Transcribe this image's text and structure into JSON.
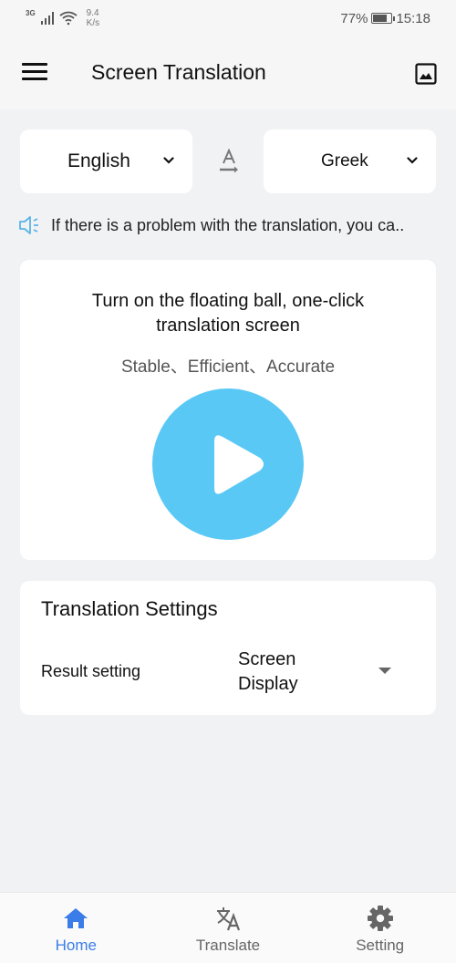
{
  "status_bar": {
    "network_type": "3G",
    "speed_value": "9.4",
    "speed_unit": "K/s",
    "battery_percent": "77%",
    "battery_level": 0.77,
    "time": "15:18"
  },
  "header": {
    "title": "Screen Translation",
    "menu_icon": "hamburger-menu-icon",
    "right_icon": "image-icon"
  },
  "languages": {
    "source": "English",
    "target": "Greek",
    "swap_icon": "text-direction-icon"
  },
  "notice": {
    "icon": "speaker-icon",
    "text": "If there is a problem with the translation, you ca.."
  },
  "main_card": {
    "title": "Turn on the floating ball, one-click translation screen",
    "subtitle": "Stable、Efficient、Accurate",
    "play_icon": "play-icon"
  },
  "settings": {
    "title": "Translation Settings",
    "rows": [
      {
        "label": "Result setting",
        "value": "Screen Display"
      }
    ]
  },
  "bottom_nav": {
    "items": [
      {
        "label": "Home",
        "icon": "home-icon",
        "active": true
      },
      {
        "label": "Translate",
        "icon": "translate-icon",
        "active": false
      },
      {
        "label": "Setting",
        "icon": "gear-icon",
        "active": false
      }
    ]
  },
  "colors": {
    "accent": "#3b7de8",
    "play_button": "#5ac8f5",
    "notice_icon": "#5ab4e8",
    "background": "#f1f2f4"
  }
}
